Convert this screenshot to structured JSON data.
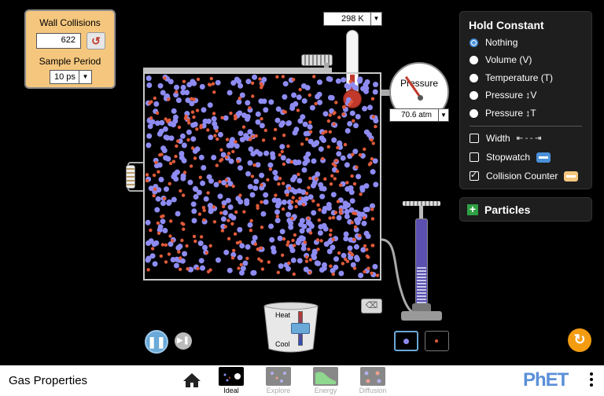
{
  "collision_counter": {
    "title": "Wall Collisions",
    "value": "622",
    "sample_period_label": "Sample Period",
    "sample_period_value": "10 ps"
  },
  "thermometer": {
    "readout": "298 K",
    "fill_fraction": 0.3
  },
  "gauge": {
    "title": "Pressure",
    "readout": "70.6 atm"
  },
  "hold_constant": {
    "title": "Hold Constant",
    "options": [
      {
        "label": "Nothing",
        "selected": true
      },
      {
        "label": "Volume (V)",
        "selected": false
      },
      {
        "label": "Temperature (T)",
        "selected": false
      },
      {
        "label": "Pressure ↕V",
        "selected": false
      },
      {
        "label": "Pressure ↕T",
        "selected": false
      }
    ],
    "tools": [
      {
        "label": "Width",
        "checked": false,
        "icon": "width-arrows-icon",
        "icon_glyph": "⇤ - - ⇥"
      },
      {
        "label": "Stopwatch",
        "checked": false,
        "icon": "stopwatch-icon"
      },
      {
        "label": "Collision Counter",
        "checked": true,
        "icon": "collision-counter-icon"
      }
    ]
  },
  "particles_panel": {
    "label": "Particles",
    "expand_glyph": "+"
  },
  "heater": {
    "heat_label": "Heat",
    "cool_label": "Cool"
  },
  "navbar": {
    "sim_title": "Gas Properties",
    "screens": [
      {
        "label": "Ideal",
        "selected": true
      },
      {
        "label": "Explore",
        "selected": false
      },
      {
        "label": "Energy",
        "selected": false
      },
      {
        "label": "Diffusion",
        "selected": false
      }
    ],
    "logo": "PhET"
  },
  "colors": {
    "heavy_particle": "#8e8cf2",
    "light_particle": "#e05a3a",
    "panel_bg": "#1e1e1e",
    "accent": "#6aa9d8"
  }
}
